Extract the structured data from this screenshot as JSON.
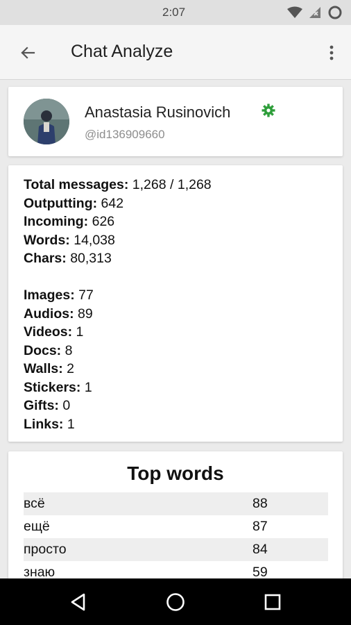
{
  "status_bar": {
    "time": "2:07"
  },
  "app_bar": {
    "title": "Chat Analyze"
  },
  "profile": {
    "name": "Anastasia Rusinovich",
    "id": "@id136909660"
  },
  "stats": {
    "group1": [
      {
        "label": "Total messages:",
        "value": "1,268 / 1,268"
      },
      {
        "label": "Outputting:",
        "value": "642"
      },
      {
        "label": "Incoming:",
        "value": "626"
      },
      {
        "label": "Words:",
        "value": "14,038"
      },
      {
        "label": "Chars:",
        "value": "80,313"
      }
    ],
    "group2": [
      {
        "label": "Images:",
        "value": "77"
      },
      {
        "label": "Audios:",
        "value": "89"
      },
      {
        "label": "Videos:",
        "value": "1"
      },
      {
        "label": "Docs:",
        "value": "8"
      },
      {
        "label": "Walls:",
        "value": "2"
      },
      {
        "label": "Stickers:",
        "value": "1"
      },
      {
        "label": "Gifts:",
        "value": "0"
      },
      {
        "label": "Links:",
        "value": "1"
      }
    ]
  },
  "top_words": {
    "title": "Top words",
    "rows": [
      {
        "word": "всё",
        "count": "88"
      },
      {
        "word": "ещё",
        "count": "87"
      },
      {
        "word": "просто",
        "count": "84"
      },
      {
        "word": "знаю",
        "count": "59"
      }
    ]
  },
  "colors": {
    "accent_green": "#2e9e3a",
    "nav_bg": "#000000"
  }
}
